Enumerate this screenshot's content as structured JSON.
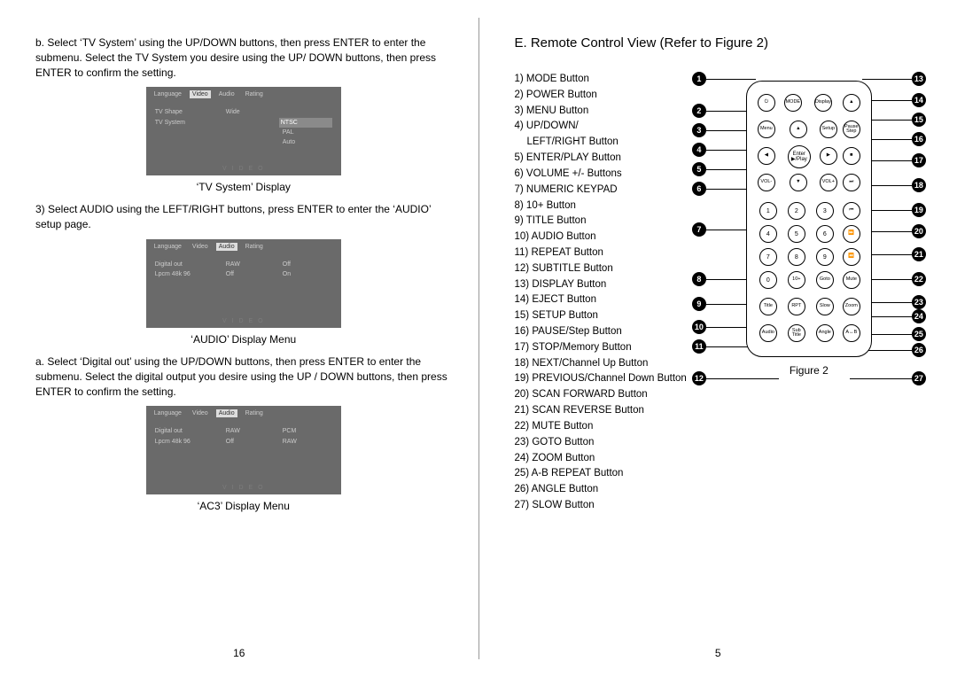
{
  "left": {
    "step_b": "b. Select ‘TV System’ using the UP/DOWN buttons, then press ENTER to enter the submenu. Select the TV System you desire using the UP/ DOWN buttons, then press ENTER to confirm the setting.",
    "caption1": "‘TV System’ Display",
    "step_3": "3) Select AUDIO using the LEFT/RIGHT buttons, press ENTER to enter the ‘AUDIO’ setup page.",
    "caption2": "‘AUDIO’ Display Menu",
    "step_a": "a. Select ‘Digital out’ using the UP/DOWN buttons, then press ENTER to enter the submenu. Select the digital output you desire using the UP / DOWN buttons, then press ENTER to confirm the setting.",
    "caption3": "‘AC3’ Display Menu",
    "page_num": "16",
    "menu1": {
      "tabs": [
        "Language",
        "Video",
        "Audio",
        "Rating"
      ],
      "active_tab": 1,
      "rows": [
        {
          "c1": "TV Shape",
          "c2": "Wide",
          "c3": ""
        },
        {
          "c1": "TV System",
          "c2": "",
          "c3": "NTSC"
        },
        {
          "c1": "",
          "c2": "",
          "c3": "PAL"
        },
        {
          "c1": "",
          "c2": "",
          "c3": "Auto"
        }
      ]
    },
    "menu2": {
      "tabs": [
        "Language",
        "Video",
        "Audio",
        "Rating"
      ],
      "active_tab": 2,
      "rows": [
        {
          "c1": "Digital out",
          "c2": "RAW",
          "c3": "Off"
        },
        {
          "c1": "Lpcm 48k 96",
          "c2": "Off",
          "c3": "On"
        }
      ]
    },
    "menu3": {
      "tabs": [
        "Language",
        "Video",
        "Audio",
        "Rating"
      ],
      "active_tab": 2,
      "rows": [
        {
          "c1": "Digital out",
          "c2": "RAW",
          "c3": "PCM"
        },
        {
          "c1": "Lpcm 48k 96",
          "c2": "Off",
          "c3": "RAW"
        }
      ]
    }
  },
  "right": {
    "title": "E. Remote Control View (Refer to Figure 2)",
    "items": [
      "1) MODE Button",
      "2) POWER Button",
      "3) MENU Button",
      "4) UP/DOWN/",
      "LEFT/RIGHT Button",
      "5) ENTER/PLAY Button",
      "6) VOLUME +/- Buttons",
      "7) NUMERIC KEYPAD",
      "8) 10+ Button",
      "9) TITLE Button",
      "10) AUDIO Button",
      "11) REPEAT Button",
      "12) SUBTITLE Button",
      "13) DISPLAY Button",
      "14) EJECT Button",
      "15) SETUP Button",
      "16) PAUSE/Step Button",
      "17) STOP/Memory Button",
      "18) NEXT/Channel Up Button",
      "19) PREVIOUS/Channel Down Button",
      "20) SCAN FORWARD Button",
      "21) SCAN REVERSE Button",
      "22) MUTE Button",
      "23) GOTO Button",
      "24) ZOOM Button",
      "25) A-B REPEAT Button",
      "26) ANGLE Button",
      "27) SLOW Button"
    ],
    "figure_caption": "Figure 2",
    "page_num": "5",
    "remote_buttons": {
      "r1": [
        "⏻",
        "MODE",
        "Display",
        "▲"
      ],
      "r2": [
        "Menu",
        "▲",
        "Setup",
        "Pause Step"
      ],
      "r3": [
        "◀",
        "Enter ▶/Play",
        "▶",
        "■"
      ],
      "r4": [
        "VOL-",
        "▼",
        "VOL+",
        "⏭"
      ],
      "n1": [
        "1",
        "2",
        "3",
        "⏮"
      ],
      "n2": [
        "4",
        "5",
        "6",
        "⏩"
      ],
      "n3": [
        "7",
        "8",
        "9",
        "⏪"
      ],
      "n4": [
        "0",
        "10+",
        "Goto",
        "Mute"
      ],
      "r5": [
        "Title",
        "RPT",
        "Slow",
        "Zoom"
      ],
      "r6": [
        "Audio",
        "Sub Title",
        "Angle",
        "A↔B"
      ]
    },
    "callouts_left": [
      "1",
      "2",
      "3",
      "4",
      "5",
      "6",
      "7",
      "8",
      "9",
      "10",
      "11",
      "12"
    ],
    "callouts_right": [
      "13",
      "14",
      "15",
      "16",
      "17",
      "18",
      "19",
      "20",
      "21",
      "22",
      "23",
      "24",
      "25",
      "26",
      "27"
    ]
  }
}
